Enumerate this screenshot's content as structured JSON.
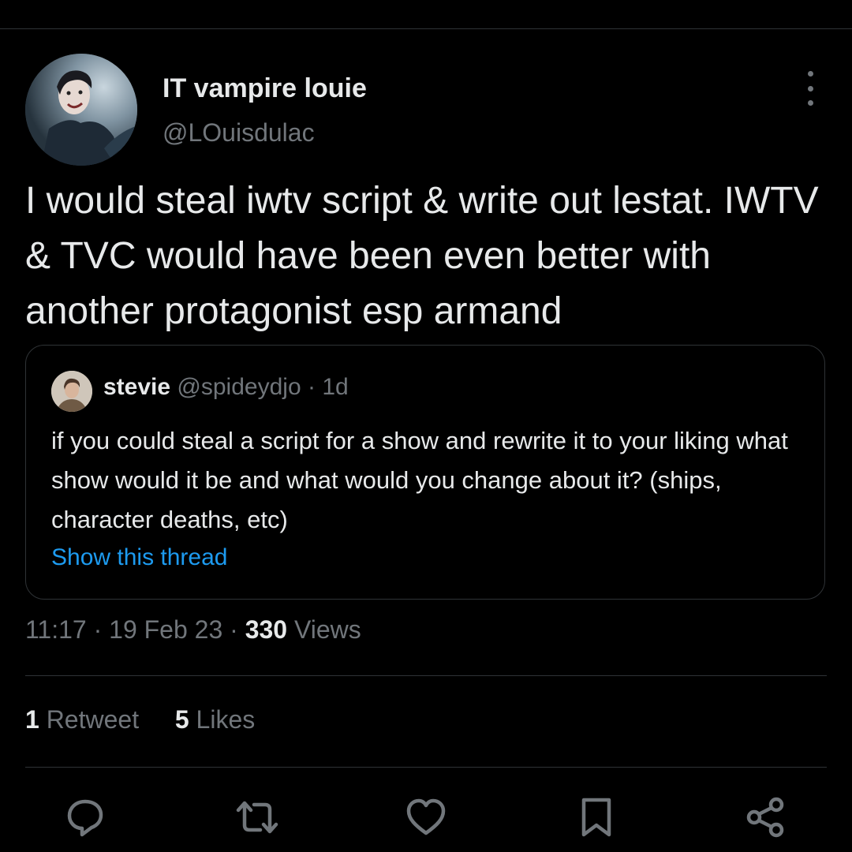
{
  "tweet": {
    "author": {
      "name": "IT vampire louie",
      "handle": "@LOuisdulac"
    },
    "text": "I would steal iwtv script & write out lestat. IWTV & TVC would have been even better with another protagonist esp armand",
    "quote": {
      "name": "stevie",
      "handle": "@spideydjo",
      "separator": "·",
      "time": "1d",
      "text": "if you could steal a script for a show and rewrite it to your liking what show would it be and what would you change about it? (ships, character deaths, etc)",
      "show_thread_label": "Show this thread"
    },
    "meta": {
      "time": "11:17",
      "dot": "·",
      "date": "19 Feb 23",
      "views_count": "330",
      "views_label": "Views"
    },
    "stats": {
      "retweets_count": "1",
      "retweets_label": "Retweet",
      "likes_count": "5",
      "likes_label": "Likes"
    }
  },
  "actions": {
    "icons": [
      "reply-icon",
      "retweet-icon",
      "like-icon",
      "bookmark-icon",
      "share-icon"
    ]
  },
  "colors": {
    "background": "#000000",
    "text_primary": "#e7e9ea",
    "text_secondary": "#71767b",
    "link": "#1d9bf0",
    "border": "#2f3336"
  }
}
